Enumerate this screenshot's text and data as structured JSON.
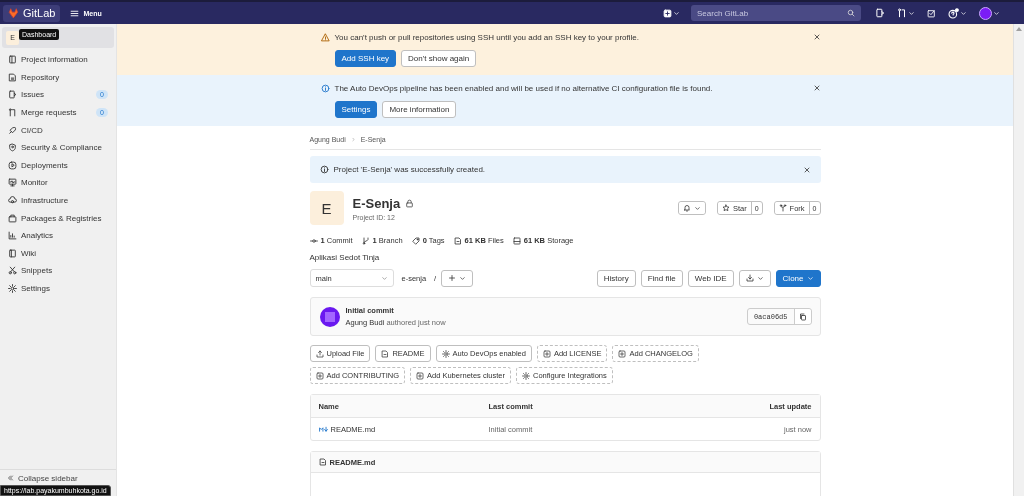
{
  "topbar": {
    "logo": "GitLab",
    "menu": "Menu",
    "search": {
      "placeholder": "Search GitLab"
    }
  },
  "tooltip": "Dashboard",
  "sidebar": {
    "project_avatar": "E",
    "items": [
      {
        "label": "Project information"
      },
      {
        "label": "Repository"
      },
      {
        "label": "Issues",
        "count": "0"
      },
      {
        "label": "Merge requests",
        "count": "0"
      },
      {
        "label": "CI/CD"
      },
      {
        "label": "Security & Compliance"
      },
      {
        "label": "Deployments"
      },
      {
        "label": "Monitor"
      },
      {
        "label": "Infrastructure"
      },
      {
        "label": "Packages & Registries"
      },
      {
        "label": "Analytics"
      },
      {
        "label": "Wiki"
      },
      {
        "label": "Snippets"
      },
      {
        "label": "Settings"
      }
    ],
    "collapse": "Collapse sidebar"
  },
  "alerts": [
    {
      "kind": "warning",
      "text": "You can't push or pull repositories using SSH until you add an SSH key to your profile.",
      "buttons": [
        {
          "label": "Add SSH key",
          "kind": "primary"
        },
        {
          "label": "Don't show again",
          "kind": "default"
        }
      ]
    },
    {
      "kind": "info",
      "text": "The Auto DevOps pipeline has been enabled and will be used if no alternative CI configuration file is found.",
      "buttons": [
        {
          "label": "Settings",
          "kind": "primary"
        },
        {
          "label": "More information",
          "kind": "default"
        }
      ]
    }
  ],
  "breadcrumb": [
    "Agung Budi",
    "E-Senja"
  ],
  "flash": "Project 'E-Senja' was successfully created.",
  "project": {
    "avatar": "E",
    "name": "E-Senja",
    "id": "Project ID: 12",
    "star": {
      "label": "Star",
      "count": "0"
    },
    "fork": {
      "label": "Fork",
      "count": "0"
    }
  },
  "stats": [
    {
      "count": "1",
      "label": "Commit"
    },
    {
      "count": "1",
      "label": "Branch"
    },
    {
      "count": "0",
      "label": "Tags"
    },
    {
      "count": "61 KB",
      "label": "Files"
    },
    {
      "count": "61 KB",
      "label": "Storage"
    }
  ],
  "description": "Aplikasi Sedot Tinja",
  "repo_bar": {
    "branch": "main",
    "path": "e-senja",
    "separator": "/",
    "buttons": [
      "History",
      "Find file",
      "Web IDE"
    ],
    "clone": "Clone"
  },
  "commit": {
    "title": "Initial commit",
    "author": "Agung Budi",
    "meta": "authored just now",
    "sha": "0aca06d5"
  },
  "actions": [
    {
      "label": "Upload File",
      "kind": "solid"
    },
    {
      "label": "README",
      "kind": "solid"
    },
    {
      "label": "Auto DevOps enabled",
      "kind": "solid"
    },
    {
      "label": "Add LICENSE",
      "kind": "dashed"
    },
    {
      "label": "Add CHANGELOG",
      "kind": "dashed"
    },
    {
      "label": "Add CONTRIBUTING",
      "kind": "dashed"
    },
    {
      "label": "Add Kubernetes cluster",
      "kind": "dashed"
    },
    {
      "label": "Configure Integrations",
      "kind": "dashed"
    }
  ],
  "table": {
    "columns": [
      "Name",
      "Last commit",
      "Last update"
    ],
    "rows": [
      [
        "README.md",
        "Initial commit",
        "just now"
      ]
    ]
  },
  "readme": {
    "title": "README.md"
  },
  "status_url": "https://lab.payakumbuhkota.go.id"
}
